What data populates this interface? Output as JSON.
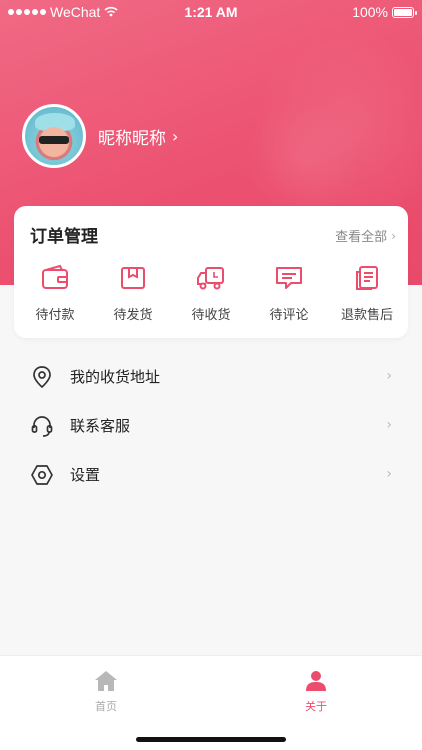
{
  "status_bar": {
    "carrier": "WeChat",
    "time": "1:21 AM",
    "battery": "100%"
  },
  "profile": {
    "nickname": "昵称昵称",
    "chevron": "›"
  },
  "orders": {
    "title": "订单管理",
    "view_all": "查看全部",
    "items": [
      {
        "label": "待付款",
        "icon": "wallet-icon"
      },
      {
        "label": "待发货",
        "icon": "package-icon"
      },
      {
        "label": "待收货",
        "icon": "truck-icon"
      },
      {
        "label": "待评论",
        "icon": "comment-icon"
      },
      {
        "label": "退款售后",
        "icon": "refund-icon"
      }
    ]
  },
  "menu": [
    {
      "label": "我的收货地址",
      "icon": "location-pin-icon"
    },
    {
      "label": "联系客服",
      "icon": "headset-icon"
    },
    {
      "label": "设置",
      "icon": "settings-hex-icon"
    }
  ],
  "tabs": [
    {
      "label": "首页",
      "icon": "home-icon",
      "active": false
    },
    {
      "label": "关于",
      "icon": "user-icon",
      "active": true
    }
  ],
  "colors": {
    "accent": "#ec4d6d",
    "header": "#ec5070"
  }
}
